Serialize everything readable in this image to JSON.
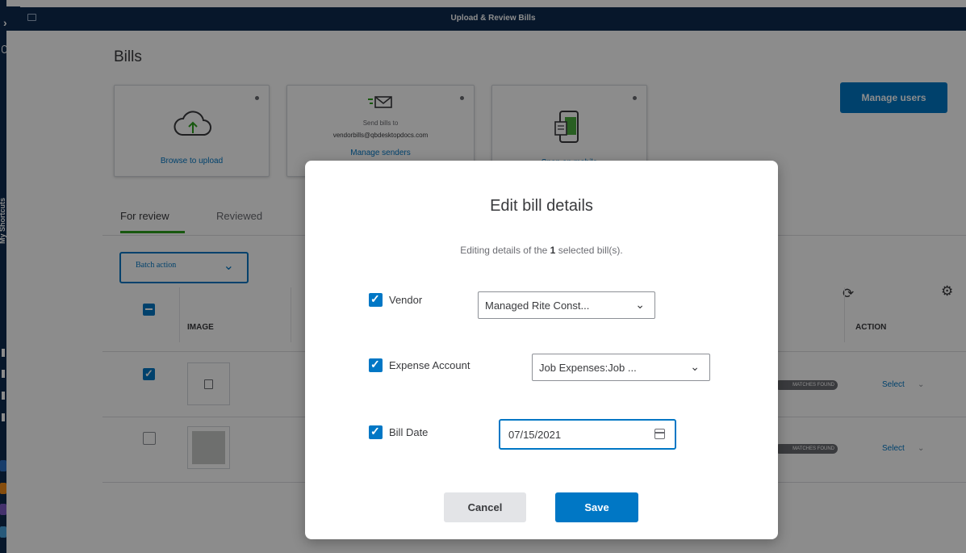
{
  "window": {
    "title": "Upload & Review Bills"
  },
  "sidebar": {
    "shortcuts_label": "My Shortcuts"
  },
  "page": {
    "title": "Bills"
  },
  "upload_cards": [
    {
      "link": "Browse to upload"
    },
    {
      "line1": "Send bills to",
      "line2": "vendorbills@qbdesktopdocs.com",
      "link": "Manage senders"
    },
    {
      "link": "Snap on mobile"
    }
  ],
  "header": {
    "manage_users": "Manage users"
  },
  "tabs": [
    {
      "label": "For review"
    },
    {
      "label": "Reviewed"
    }
  ],
  "toolbar": {
    "batch_action": "Batch action"
  },
  "table": {
    "columns": {
      "image": "IMAGE",
      "action": "ACTION"
    },
    "rows": [
      {
        "checked": true,
        "badge": "MATCHES FOUND",
        "action": "Select"
      },
      {
        "checked": false,
        "badge": "MATCHES FOUND",
        "action": "Select"
      }
    ]
  },
  "modal": {
    "title": "Edit bill details",
    "subtitle_prefix": "Editing details of the",
    "subtitle_count": "1",
    "subtitle_suffix": "selected bill(s).",
    "vendor_label": "Vendor",
    "vendor_value": "Managed Rite Const...",
    "expense_label": "Expense Account",
    "expense_value": "Job Expenses:Job ...",
    "date_label": "Bill Date",
    "date_value": "07/15/2021",
    "cancel": "Cancel",
    "save": "Save"
  },
  "colors": {
    "brand_navy": "#0d2b4f",
    "primary_blue": "#0077c5",
    "tab_green": "#2ca01c"
  }
}
